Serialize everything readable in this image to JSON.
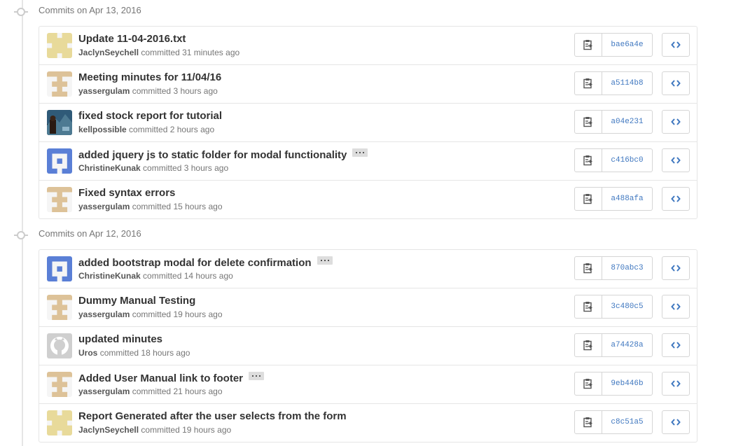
{
  "colors": {
    "link": "#4078c0",
    "muted": "#767676",
    "border": "#e5e5e5"
  },
  "groups": [
    {
      "label": "Commits",
      "date": "on Apr 13, 2016",
      "commits": [
        {
          "title": "Update 11-04-2016.txt",
          "author": "JaclynSeychell",
          "action": "committed",
          "time": "31 minutes ago",
          "sha": "bae6a4e",
          "has_ellipsis": false,
          "avatar": "identicon-yellow"
        },
        {
          "title": "Meeting minutes for 11/04/16",
          "author": "yassergulam",
          "action": "committed",
          "time": "3 hours ago",
          "sha": "a5114b8",
          "has_ellipsis": false,
          "avatar": "identicon-tan"
        },
        {
          "title": "fixed stock report for tutorial",
          "author": "kellpossible",
          "action": "committed",
          "time": "2 hours ago",
          "sha": "a04e231",
          "has_ellipsis": false,
          "avatar": "photo"
        },
        {
          "title": "added jquery js to static folder for modal functionality",
          "author": "ChristineKunak",
          "action": "committed",
          "time": "3 hours ago",
          "sha": "c416bc0",
          "has_ellipsis": true,
          "avatar": "identicon-blue"
        },
        {
          "title": "Fixed syntax errors",
          "author": "yassergulam",
          "action": "committed",
          "time": "15 hours ago",
          "sha": "a488afa",
          "has_ellipsis": false,
          "avatar": "identicon-tan"
        }
      ]
    },
    {
      "label": "Commits",
      "date": "on Apr 12, 2016",
      "commits": [
        {
          "title": "added bootstrap modal for delete confirmation",
          "author": "ChristineKunak",
          "action": "committed",
          "time": "14 hours ago",
          "sha": "870abc3",
          "has_ellipsis": true,
          "avatar": "identicon-blue"
        },
        {
          "title": "Dummy Manual Testing",
          "author": "yassergulam",
          "action": "committed",
          "time": "19 hours ago",
          "sha": "3c480c5",
          "has_ellipsis": false,
          "avatar": "identicon-tan"
        },
        {
          "title": "updated minutes",
          "author": "Uros",
          "action": "committed",
          "time": "18 hours ago",
          "sha": "a74428a",
          "has_ellipsis": false,
          "avatar": "github-octocat"
        },
        {
          "title": "Added User Manual link to footer",
          "author": "yassergulam",
          "action": "committed",
          "time": "21 hours ago",
          "sha": "9eb446b",
          "has_ellipsis": true,
          "avatar": "identicon-tan"
        },
        {
          "title": "Report Generated after the user selects from the form",
          "author": "JaclynSeychell",
          "action": "committed",
          "time": "19 hours ago",
          "sha": "c8c51a5",
          "has_ellipsis": false,
          "avatar": "identicon-yellow"
        }
      ]
    }
  ],
  "icons": {
    "copy": "clipboard-icon",
    "browse": "code-icon",
    "timeline": "commit-icon"
  }
}
